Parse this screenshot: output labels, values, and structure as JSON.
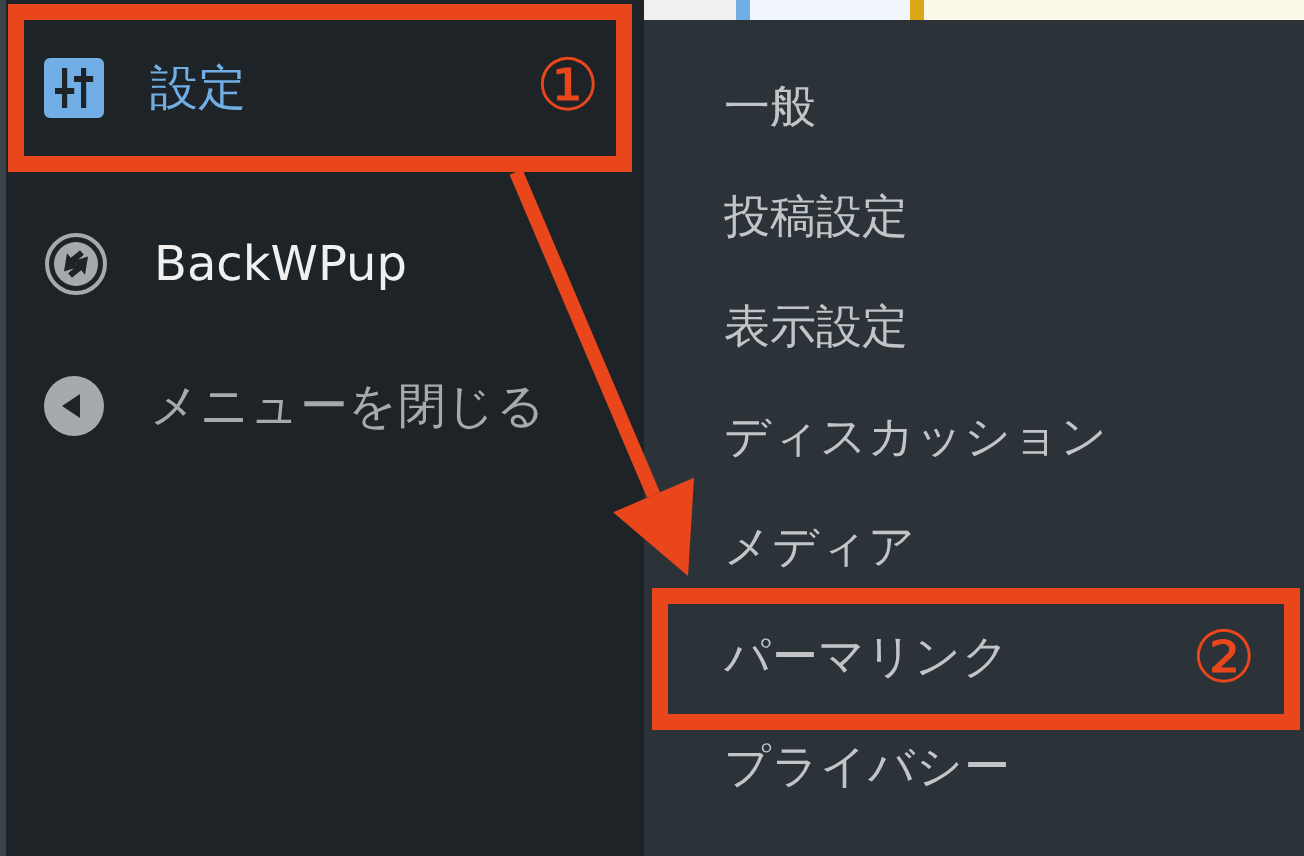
{
  "sidebar": {
    "items": [
      {
        "label": "設定",
        "kind": "settings",
        "selected": true,
        "callout": "①"
      },
      {
        "label": "BackWPup",
        "kind": "plugin",
        "selected": false
      },
      {
        "label": "メニューを閉じる",
        "kind": "collapse",
        "selected": false
      }
    ]
  },
  "submenu": {
    "items": [
      {
        "label": "一般"
      },
      {
        "label": "投稿設定"
      },
      {
        "label": "表示設定"
      },
      {
        "label": "ディスカッション"
      },
      {
        "label": "メディア"
      },
      {
        "label": "パーマリンク",
        "callout": "②"
      },
      {
        "label": "プライバシー"
      }
    ]
  }
}
